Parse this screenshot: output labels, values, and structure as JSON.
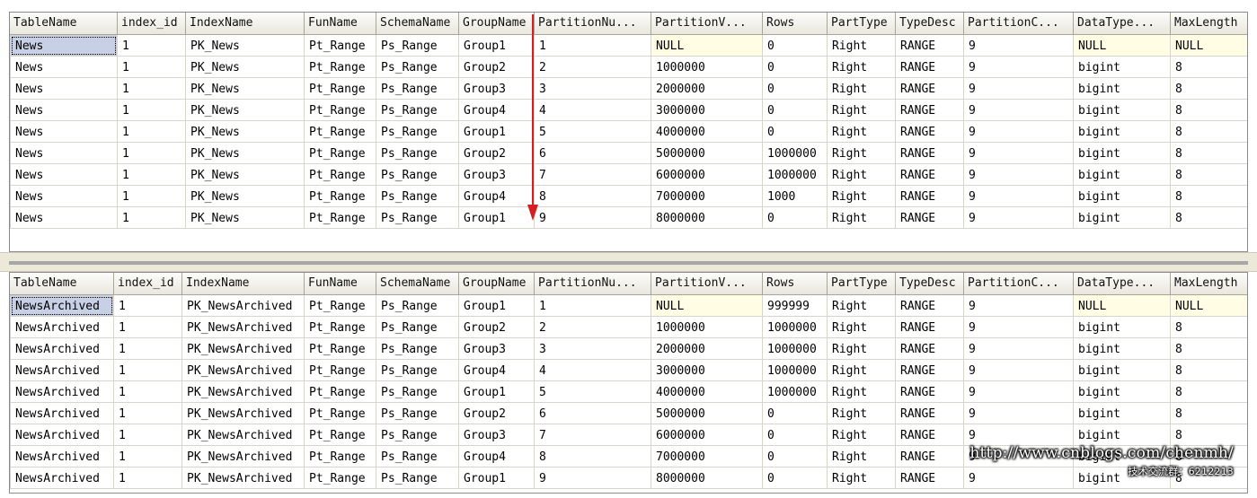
{
  "top_grid": {
    "columns": [
      "TableName",
      "index_id",
      "IndexName",
      "FunName",
      "SchemaName",
      "GroupName",
      "PartitionNu...",
      "PartitionV...",
      "Rows",
      "PartType",
      "TypeDesc",
      "PartitionC...",
      "DataType...",
      "MaxLength"
    ],
    "rows": [
      [
        "News",
        "1",
        "PK_News",
        "Pt_Range",
        "Ps_Range",
        "Group1",
        "1",
        "NULL",
        "0",
        "Right",
        "RANGE",
        "9",
        "NULL",
        "NULL"
      ],
      [
        "News",
        "1",
        "PK_News",
        "Pt_Range",
        "Ps_Range",
        "Group2",
        "2",
        "1000000",
        "0",
        "Right",
        "RANGE",
        "9",
        "bigint",
        "8"
      ],
      [
        "News",
        "1",
        "PK_News",
        "Pt_Range",
        "Ps_Range",
        "Group3",
        "3",
        "2000000",
        "0",
        "Right",
        "RANGE",
        "9",
        "bigint",
        "8"
      ],
      [
        "News",
        "1",
        "PK_News",
        "Pt_Range",
        "Ps_Range",
        "Group4",
        "4",
        "3000000",
        "0",
        "Right",
        "RANGE",
        "9",
        "bigint",
        "8"
      ],
      [
        "News",
        "1",
        "PK_News",
        "Pt_Range",
        "Ps_Range",
        "Group1",
        "5",
        "4000000",
        "0",
        "Right",
        "RANGE",
        "9",
        "bigint",
        "8"
      ],
      [
        "News",
        "1",
        "PK_News",
        "Pt_Range",
        "Ps_Range",
        "Group2",
        "6",
        "5000000",
        "1000000",
        "Right",
        "RANGE",
        "9",
        "bigint",
        "8"
      ],
      [
        "News",
        "1",
        "PK_News",
        "Pt_Range",
        "Ps_Range",
        "Group3",
        "7",
        "6000000",
        "1000000",
        "Right",
        "RANGE",
        "9",
        "bigint",
        "8"
      ],
      [
        "News",
        "1",
        "PK_News",
        "Pt_Range",
        "Ps_Range",
        "Group4",
        "8",
        "7000000",
        "1000",
        "Right",
        "RANGE",
        "9",
        "bigint",
        "8"
      ],
      [
        "News",
        "1",
        "PK_News",
        "Pt_Range",
        "Ps_Range",
        "Group1",
        "9",
        "8000000",
        "0",
        "Right",
        "RANGE",
        "9",
        "bigint",
        "8"
      ]
    ]
  },
  "bottom_grid": {
    "columns": [
      "TableName",
      "index_id",
      "IndexName",
      "FunName",
      "SchemaName",
      "GroupName",
      "PartitionNu...",
      "PartitionV...",
      "Rows",
      "PartType",
      "TypeDesc",
      "PartitionC...",
      "DataType...",
      "MaxLength"
    ],
    "rows": [
      [
        "NewsArchived",
        "1",
        "PK_NewsArchived",
        "Pt_Range",
        "Ps_Range",
        "Group1",
        "1",
        "NULL",
        "999999",
        "Right",
        "RANGE",
        "9",
        "NULL",
        "NULL"
      ],
      [
        "NewsArchived",
        "1",
        "PK_NewsArchived",
        "Pt_Range",
        "Ps_Range",
        "Group2",
        "2",
        "1000000",
        "1000000",
        "Right",
        "RANGE",
        "9",
        "bigint",
        "8"
      ],
      [
        "NewsArchived",
        "1",
        "PK_NewsArchived",
        "Pt_Range",
        "Ps_Range",
        "Group3",
        "3",
        "2000000",
        "1000000",
        "Right",
        "RANGE",
        "9",
        "bigint",
        "8"
      ],
      [
        "NewsArchived",
        "1",
        "PK_NewsArchived",
        "Pt_Range",
        "Ps_Range",
        "Group4",
        "4",
        "3000000",
        "1000000",
        "Right",
        "RANGE",
        "9",
        "bigint",
        "8"
      ],
      [
        "NewsArchived",
        "1",
        "PK_NewsArchived",
        "Pt_Range",
        "Ps_Range",
        "Group1",
        "5",
        "4000000",
        "1000000",
        "Right",
        "RANGE",
        "9",
        "bigint",
        "8"
      ],
      [
        "NewsArchived",
        "1",
        "PK_NewsArchived",
        "Pt_Range",
        "Ps_Range",
        "Group2",
        "6",
        "5000000",
        "0",
        "Right",
        "RANGE",
        "9",
        "bigint",
        "8"
      ],
      [
        "NewsArchived",
        "1",
        "PK_NewsArchived",
        "Pt_Range",
        "Ps_Range",
        "Group3",
        "7",
        "6000000",
        "0",
        "Right",
        "RANGE",
        "9",
        "bigint",
        "8"
      ],
      [
        "NewsArchived",
        "1",
        "PK_NewsArchived",
        "Pt_Range",
        "Ps_Range",
        "Group4",
        "8",
        "7000000",
        "0",
        "Right",
        "RANGE",
        "9",
        "bigint",
        "8"
      ],
      [
        "NewsArchived",
        "1",
        "PK_NewsArchived",
        "Pt_Range",
        "Ps_Range",
        "Group1",
        "9",
        "8000000",
        "0",
        "Right",
        "RANGE",
        "9",
        "bigint",
        "8"
      ]
    ]
  },
  "annotation": {
    "arrow_color": "#d42020",
    "arrow_icon": "down-arrow-icon"
  },
  "watermark": {
    "url": "http://www.cnblogs.com/chenmh/",
    "caption": "技术交流群：6212213"
  },
  "colors": {
    "null_highlight": "#fffde3",
    "selected_cell": "#c7d0e5",
    "header_bg": "#ece9d8"
  }
}
